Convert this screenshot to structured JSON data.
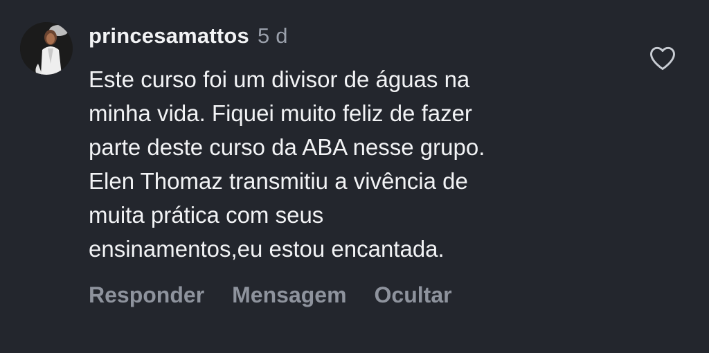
{
  "comment": {
    "username": "princesamattos",
    "timestamp": "5 d",
    "text_lines": [
      "Este curso foi um divisor de águas na",
      "minha vida. Fiquei muito feliz de fazer",
      "parte deste curso da ABA nesse grupo.",
      "Elen Thomaz transmitiu a vivência de",
      "muita prática com seus",
      "ensinamentos,eu estou encantada."
    ],
    "like_icon": "heart-outline-icon",
    "actions": {
      "reply": "Responder",
      "message": "Mensagem",
      "hide": "Ocultar"
    }
  },
  "colors": {
    "background": "#23262d",
    "text": "#f2f3f5",
    "muted": "#9aa0ab",
    "action": "#8e939d"
  }
}
